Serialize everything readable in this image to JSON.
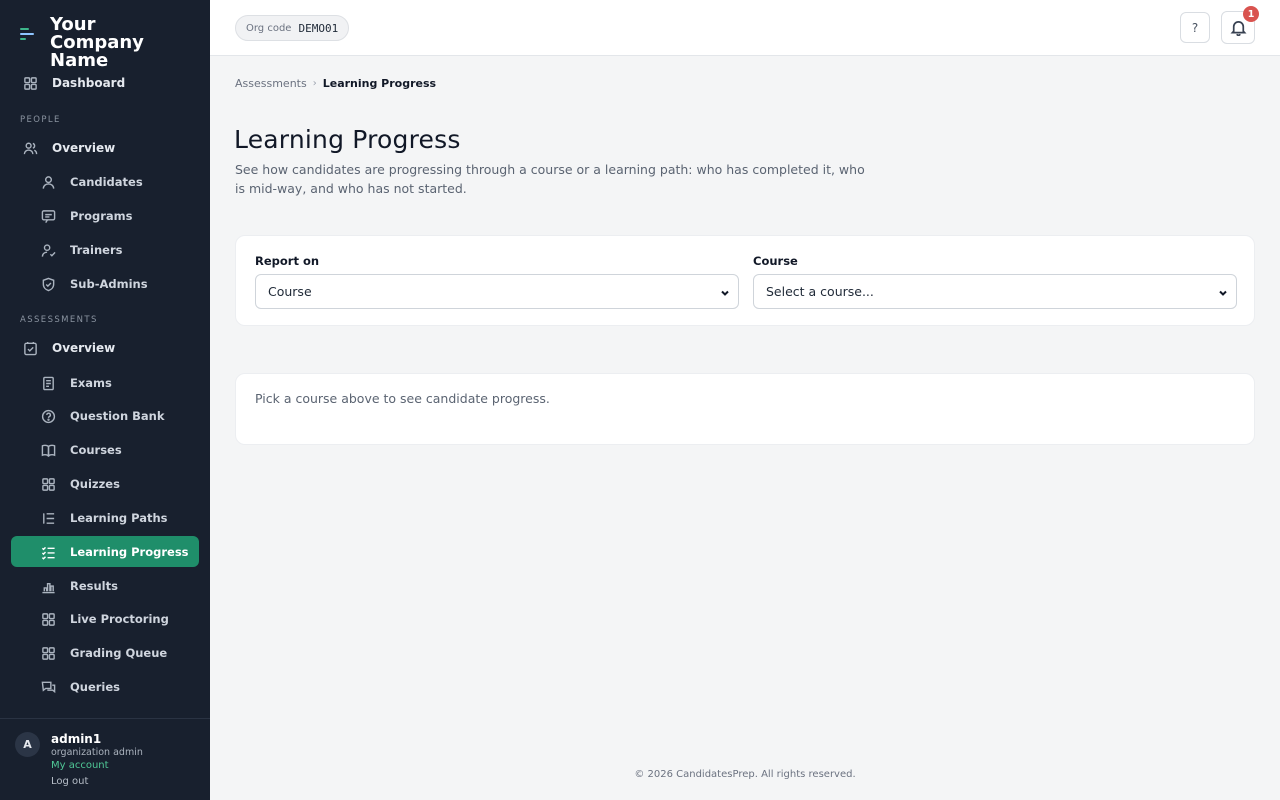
{
  "brand": {
    "name": "Your Company Name"
  },
  "sidebar": {
    "dashboard": "Dashboard",
    "people_section": "PEOPLE",
    "people_overview": "Overview",
    "people_items": [
      "Candidates",
      "Programs",
      "Trainers",
      "Sub-Admins"
    ],
    "assessments_section": "ASSESSMENTS",
    "assessments_overview": "Overview",
    "assessments_items": [
      "Exams",
      "Question Bank",
      "Courses",
      "Quizzes",
      "Learning Paths",
      "Learning Progress",
      "Results",
      "Live Proctoring",
      "Grading Queue",
      "Queries"
    ],
    "active_item": "Learning Progress"
  },
  "user": {
    "initial": "A",
    "name": "admin1",
    "role": "organization admin",
    "my_account": "My account",
    "logout": "Log out"
  },
  "topbar": {
    "org_label": "Org code",
    "org_code": "DEMO01",
    "help_label": "?",
    "notification_count": "1"
  },
  "breadcrumb": {
    "parent": "Assessments",
    "separator": "›",
    "current": "Learning Progress"
  },
  "page": {
    "title": "Learning Progress",
    "description": "See how candidates are progressing through a course or a learning path: who has completed it, who is mid-way, and who has not started."
  },
  "filters": {
    "report_on_label": "Report on",
    "report_on_value": "Course",
    "course_label": "Course",
    "course_value": "Select a course..."
  },
  "empty_state": {
    "message": "Pick a course above to see candidate progress."
  },
  "footer": {
    "text": "© 2026 CandidatesPrep. All rights reserved."
  },
  "colors": {
    "sidebar_bg": "#18202e",
    "accent": "#1f8e6a",
    "badge": "#d9534f"
  }
}
